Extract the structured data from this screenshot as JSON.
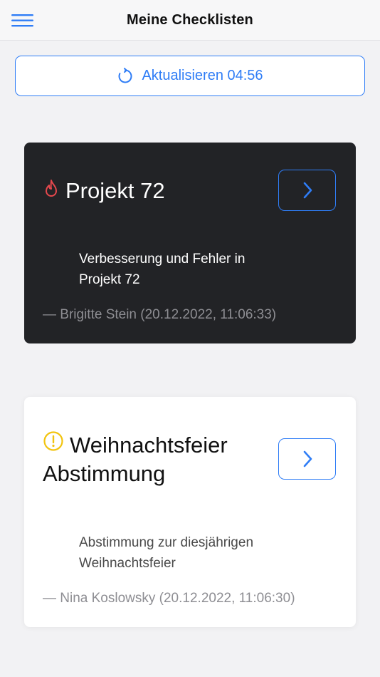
{
  "header": {
    "title": "Meine Checklisten",
    "menu_icon": "hamburger-menu-icon"
  },
  "refresh": {
    "label": "Aktualisieren 04:56",
    "icon": "refresh-icon",
    "color": "#2f7df6"
  },
  "checklists": [
    {
      "title": "Projekt 72",
      "icon": "flame-icon",
      "icon_color": "#e5484d",
      "description": "Verbesserung und Fehler in Projekt 72",
      "author": "— Brigitte Stein (20.12.2022, 11:06:33)",
      "theme": "dark"
    },
    {
      "title": "Weihnachtsfeier Abstimmung",
      "icon": "warning-circle-icon",
      "icon_color": "#f2c40f",
      "description": "Abstimmung zur diesjährigen Weihnachtsfeier",
      "author": "— Nina Koslowsky (20.12.2022, 11:06:30)",
      "theme": "light"
    }
  ]
}
